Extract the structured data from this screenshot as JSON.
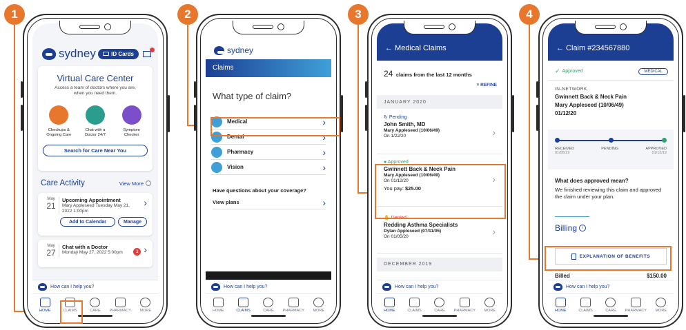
{
  "badges": [
    "1",
    "2",
    "3",
    "4"
  ],
  "nav": [
    "HOME",
    "CLAIMS",
    "CARE",
    "PHARMACY",
    "MORE"
  ],
  "help_text": "How can I help you?",
  "s1": {
    "brand": "sydney",
    "id_cards": "ID Cards",
    "vcc_title": "Virtual Care Center",
    "vcc_sub": "Access a team of doctors where you are, when you need them.",
    "opts": [
      {
        "label": "Checkups & Ongoing Care",
        "color": "#e8772e"
      },
      {
        "label": "Chat with a Doctor 24/7",
        "color": "#2a9d8f"
      },
      {
        "label": "Symptom Checker",
        "color": "#7b4fc9"
      }
    ],
    "search_btn": "Search for Care Near You",
    "activity_title": "Care Activity",
    "view_more": "View More",
    "appt": {
      "month": "May",
      "day": "21",
      "title": "Upcoming Appointment",
      "sub": "Mary Appleseed Tuesday May 21, 2022 1:00pm",
      "btn1": "Add to Calendar",
      "btn2": "Manage"
    },
    "chat": {
      "month": "May",
      "day": "27",
      "title": "Chat with a Doctor",
      "sub": "Monday May 27, 2022 5:00pm",
      "count": "3"
    }
  },
  "s2": {
    "brand": "sydney",
    "band_title": "Claims",
    "question": "What type of claim?",
    "types": [
      {
        "label": "Medical",
        "color": "#3fa0d8"
      },
      {
        "label": "Dental",
        "color": "#3fa0d8"
      },
      {
        "label": "Pharmacy",
        "color": "#3fa0d8"
      },
      {
        "label": "Vision",
        "color": "#3fa0d8"
      }
    ],
    "q_cov": "Have questions about your coverage?",
    "view_plans": "View plans"
  },
  "s3": {
    "back_title": "← Medical Claims",
    "count_num": "24",
    "count_text": "claims from the last 12 months",
    "refine": "REFINE",
    "month1": "JANUARY 2020",
    "claims": [
      {
        "status": "Pending",
        "status_color": "#1c3f94",
        "name": "John Smith, MD",
        "patient": "Mary Appleseed (10/06/49)",
        "date": "On 1/22/20",
        "pay": ""
      },
      {
        "status": "Approved",
        "status_color": "#2ea36b",
        "name": "Gwinnett Back & Neck Pain",
        "patient": "Mary Appleseed (10/06/49)",
        "date": "On 01/12/20",
        "pay_label": "You pay:",
        "pay": "$25.00"
      },
      {
        "status": "Denied",
        "status_color": "#d93f3f",
        "name": "Redding Asthma Specialists",
        "patient": "Dylan Appleseed (07/11/05)",
        "date": "On 01/05/20",
        "pay": ""
      }
    ],
    "month2": "DECEMBER 2019"
  },
  "s4": {
    "back_title": "← Claim #234567880",
    "status": "Approved",
    "tag": "MEDICAL",
    "network": "IN-NETWORK",
    "provider": "Gwinnett Back & Neck Pain",
    "patient": "Mary Appleseed (10/06/49)",
    "date": "01/12/20",
    "steps": [
      {
        "label": "RECEIVED",
        "date": "01/05/19"
      },
      {
        "label": "PENDING",
        "date": ""
      },
      {
        "label": "APPROVED",
        "date": "01/12/19"
      }
    ],
    "approved_q": "What does approved mean?",
    "approved_a": "We finished reviewing this claim and approved the claim under your plan.",
    "billing": "Billing",
    "eob": "EXPLANATION OF BENEFITS",
    "billed_label": "Billed",
    "billed_value": "$150.00"
  }
}
